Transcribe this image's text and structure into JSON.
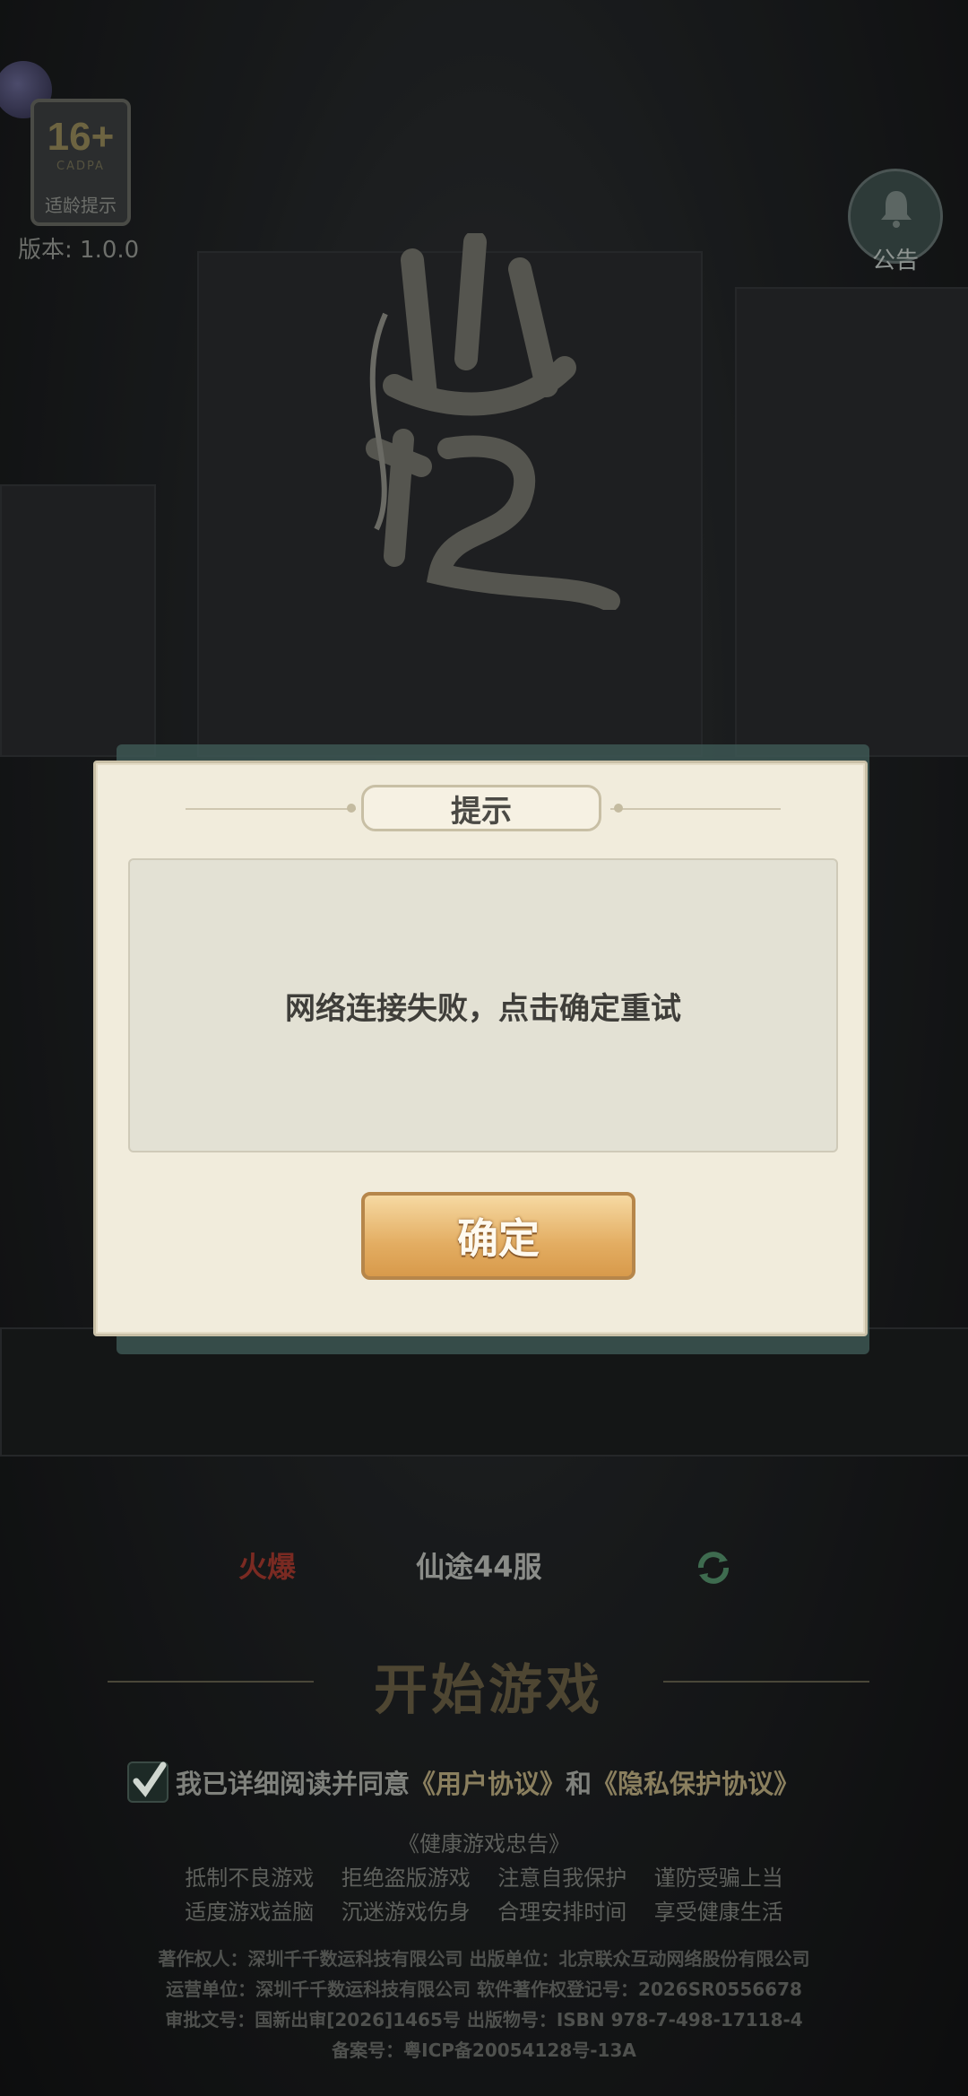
{
  "header": {
    "age_rating": "16+",
    "age_rating_org": "CADPA",
    "age_tip": "适龄提示",
    "version": "版本: 1.0.0",
    "notice_label": "公告"
  },
  "dialog": {
    "title": "提示",
    "message": "网络连接失败，点击确定重试",
    "confirm_label": "确定"
  },
  "server": {
    "hot_tag": "火爆",
    "name": "仙途44服"
  },
  "start_label": "开始游戏",
  "agreement": {
    "prefix": "我已详细阅读并同意",
    "user_agreement": "《用户协议》",
    "and": "和",
    "privacy_agreement": "《隐私保护协议》",
    "checked": true
  },
  "health_notice": {
    "title": "《健康游戏忠告》",
    "line1": "抵制不良游戏    拒绝盗版游戏    注意自我保护    谨防受骗上当",
    "line2": "适度游戏益脑    沉迷游戏伤身    合理安排时间    享受健康生活"
  },
  "legal": {
    "line1": "著作权人：深圳千千数运科技有限公司  出版单位：北京联众互动网络股份有限公司",
    "line2": "运营单位：深圳千千数运科技有限公司  软件著作权登记号：2026SR0556678",
    "line3": "审批文号：国新出审[2026]1465号  出版物号：ISBN 978-7-498-17118-4",
    "line4": "备案号：粤ICP备20054128号-13A"
  },
  "colors": {
    "dialog_bg": "#f1ecdc",
    "confirm_button": "#e3ad62",
    "hot_tag": "#7a2a22"
  }
}
